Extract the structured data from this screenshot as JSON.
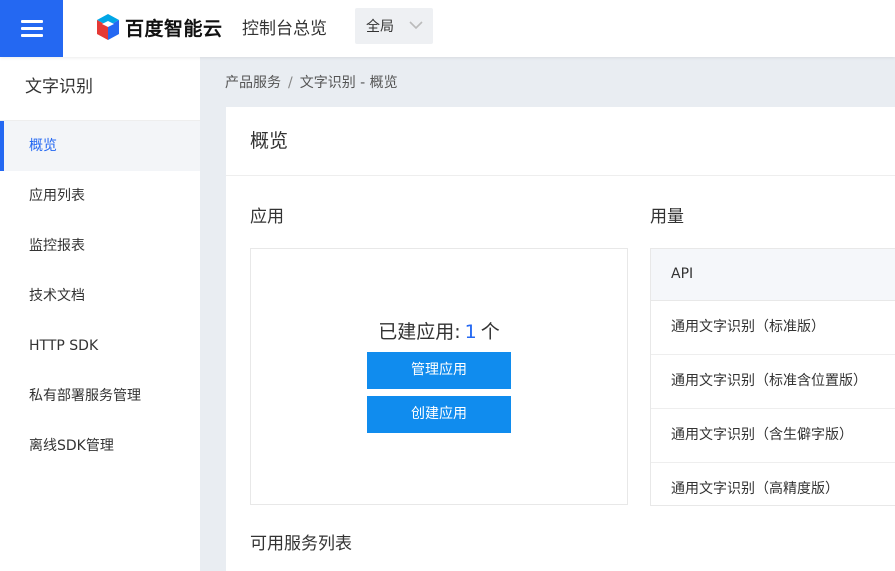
{
  "header": {
    "logo_text": "百度智能云",
    "console_title": "控制台总览",
    "region_label": "全局"
  },
  "sidebar": {
    "title": "文字识别",
    "items": [
      {
        "label": "概览"
      },
      {
        "label": "应用列表"
      },
      {
        "label": "监控报表"
      },
      {
        "label": "技术文档"
      },
      {
        "label": "HTTP SDK"
      },
      {
        "label": "私有部署服务管理"
      },
      {
        "label": "离线SDK管理"
      }
    ]
  },
  "breadcrumb": {
    "root": "产品服务",
    "separator": "/",
    "current": "文字识别 - 概览"
  },
  "main": {
    "card_title": "概览",
    "app_section": {
      "title": "应用",
      "count_prefix": "已建应用:",
      "count": "1",
      "count_suffix": "个",
      "manage_label": "管理应用",
      "create_label": "创建应用"
    },
    "usage_section": {
      "title": "用量",
      "header": "API",
      "rows": [
        "通用文字识别（标准版）",
        "通用文字识别（标准含位置版）",
        "通用文字识别（含生僻字版）",
        "通用文字识别（高精度版）"
      ]
    },
    "services_title": "可用服务列表"
  },
  "colors": {
    "brand_blue": "#2468f2",
    "button_blue": "#108cee"
  }
}
